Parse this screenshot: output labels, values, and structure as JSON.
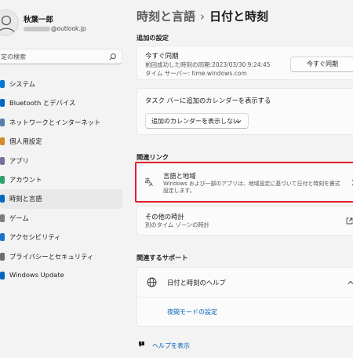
{
  "user": {
    "name": "秋葉一郎",
    "email_visible": "@outlook.jp"
  },
  "search": {
    "placeholder": "定の検索"
  },
  "nav": {
    "items": [
      {
        "label": "システム",
        "icon": "system-icon",
        "color": "#0078d4"
      },
      {
        "label": "Bluetooth とデバイス",
        "icon": "bluetooth-icon",
        "color": "#0067c0"
      },
      {
        "label": "ネットワークとインターネット",
        "icon": "network-icon",
        "color": "#5a7ea8"
      },
      {
        "label": "個人用設定",
        "icon": "brush-icon",
        "color": "#d38b2a"
      },
      {
        "label": "アプリ",
        "icon": "apps-icon",
        "color": "#7a6e9e"
      },
      {
        "label": "アカウント",
        "icon": "account-icon",
        "color": "#2ba36b"
      },
      {
        "label": "時刻と言語",
        "icon": "time-language-icon",
        "color": "#0067c0",
        "active": true
      },
      {
        "label": "ゲーム",
        "icon": "gaming-icon",
        "color": "#7d7d7d"
      },
      {
        "label": "アクセシビリティ",
        "icon": "accessibility-icon",
        "color": "#1a73c8"
      },
      {
        "label": "プライバシーとセキュリティ",
        "icon": "shield-icon",
        "color": "#6d6d6d"
      },
      {
        "label": "Windows Update",
        "icon": "update-icon",
        "color": "#0067c0"
      }
    ]
  },
  "header": {
    "parent": "時刻と言語",
    "separator": "›",
    "title": "日付と時刻"
  },
  "additional": {
    "section_title": "追加の設定",
    "sync": {
      "title": "今すぐ同期",
      "last_sync": "前回成功した時刻の同期:2023/03/30 9:24:45",
      "server": "タイム サーバー: time.windows.com",
      "button": "今すぐ同期"
    },
    "taskbar": {
      "title": "タスク バーに追加のカレンダーを表示する",
      "dropdown_value": "追加のカレンダーを表示しない"
    }
  },
  "related": {
    "section_title": "関連リンク",
    "region": {
      "title": "言語と地域",
      "description": "Windows および一部のアプリは、地域設定に基づいて日付と時刻を書式設定します。"
    },
    "other_clocks": {
      "title": "その他の時計",
      "description": "別のタイム ゾーンの時計"
    }
  },
  "support": {
    "section_title": "関連するサポート",
    "help_title": "日付と時刻のヘルプ",
    "link": "夜間モードの設定"
  },
  "footer": {
    "help": "ヘルプを表示"
  }
}
